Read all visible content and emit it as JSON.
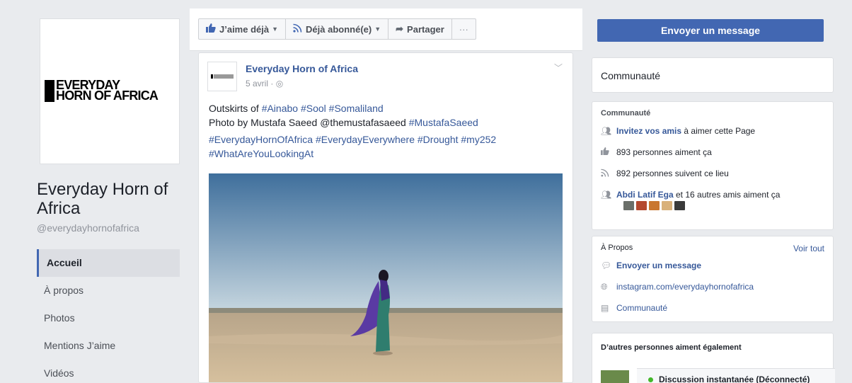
{
  "page": {
    "name": "Everyday Horn of Africa",
    "handle": "@everydayhornofafrica",
    "logo_line1": "EVERYDAY",
    "logo_line2": "HORN OF AFRICA"
  },
  "nav": [
    {
      "label": "Accueil",
      "active": true
    },
    {
      "label": "À propos"
    },
    {
      "label": "Photos"
    },
    {
      "label": "Mentions J’aime"
    },
    {
      "label": "Vidéos"
    }
  ],
  "actions": {
    "like": "J’aime déjà",
    "follow": "Déjà abonné(e)",
    "share": "Partager",
    "more": "···"
  },
  "post": {
    "author": "Everyday Horn of Africa",
    "date": "5 avril ·",
    "line1_prefix": "Outskirts of ",
    "line1_tags": "#Ainabo #Sool #Somaliland",
    "line2_prefix": "Photo by Mustafa Saeed @themustafasaeed ",
    "line2_tag": "#MustafaSaeed",
    "tags_line1": "#EverydayHornOfAfrica #EverydayEverywhere #Drought #my252",
    "tags_line2": "#WhatAreYouLookingAt"
  },
  "right": {
    "message_button": "Envoyer un message",
    "community_title": "Communauté",
    "community_head": "Communauté",
    "invite_link": "Invitez vos amis",
    "invite_rest": " à aimer cette Page",
    "likes": "893 personnes aiment ça",
    "follows": "892 personnes suivent ce lieu",
    "friends_link": "Abdi Latif Ega",
    "friends_rest": " et 16 autres amis aiment ça",
    "about_head": "À Propos",
    "see_all": "Voir tout",
    "about_message": "Envoyer un message",
    "about_instagram": "instagram.com/everydayhornofafrica",
    "about_category": "Communauté",
    "others_head": "D’autres personnes aiment également",
    "chat": "Discussion instantanée (Déconnecté)"
  },
  "colors": {
    "brand_blue": "#4267b2",
    "link_blue": "#365899",
    "online_green": "#42b72a"
  }
}
